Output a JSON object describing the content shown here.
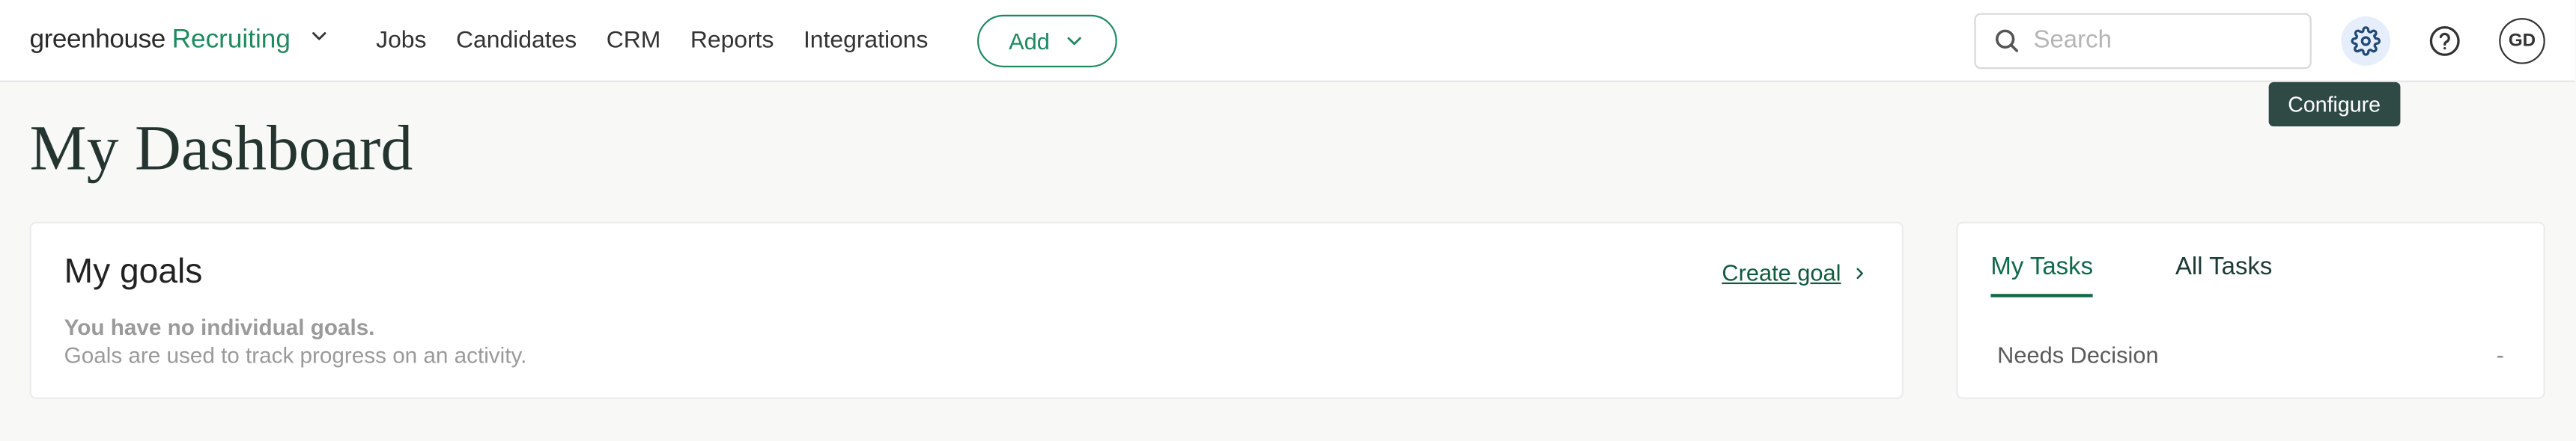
{
  "header": {
    "logo_primary": "greenhouse",
    "logo_secondary": "Recruiting",
    "nav": [
      "Jobs",
      "Candidates",
      "CRM",
      "Reports",
      "Integrations"
    ],
    "add_label": "Add",
    "search_placeholder": "Search",
    "avatar_initials": "GD",
    "tooltip_configure": "Configure"
  },
  "page_title": "My Dashboard",
  "goals": {
    "heading": "My goals",
    "create_label": "Create goal",
    "empty_line1": "You have no individual goals.",
    "empty_line2": "Goals are used to track progress on an activity."
  },
  "tasks": {
    "tabs": {
      "my": "My Tasks",
      "all": "All Tasks"
    },
    "rows": [
      {
        "label": "Needs Decision",
        "count": "-"
      }
    ]
  }
}
